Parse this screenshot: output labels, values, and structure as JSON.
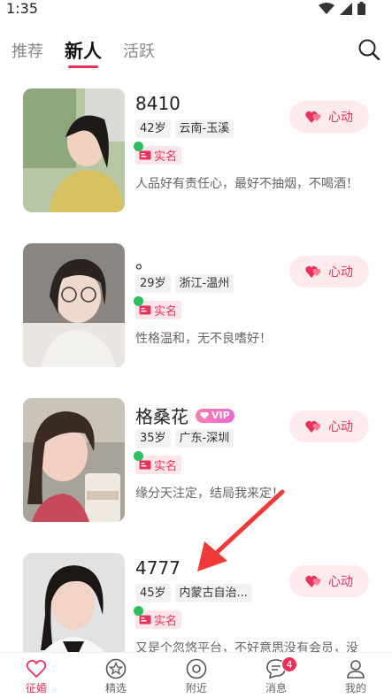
{
  "status_bar": {
    "time": "1:35"
  },
  "tabs": [
    {
      "label": "推荐",
      "active": false
    },
    {
      "label": "新人",
      "active": true
    },
    {
      "label": "活跃",
      "active": false
    }
  ],
  "profiles": [
    {
      "name": "8410",
      "vip": "",
      "age": "42岁",
      "location": "云南-玉溪",
      "verified": "实名",
      "bio": "人品好有责任心，最好不抽烟，不喝酒！",
      "like_label": "心动"
    },
    {
      "name": "。",
      "vip": "",
      "age": "29岁",
      "location": "浙江-温州",
      "verified": "实名",
      "bio": "性格温和，无不良嗜好！",
      "like_label": "心动"
    },
    {
      "name": "格桑花",
      "vip": "VIP",
      "age": "35岁",
      "location": "广东-深圳",
      "verified": "实名",
      "bio": "缘分天注定，结局我来定！",
      "like_label": "心动"
    },
    {
      "name": "4777",
      "vip": "",
      "age": "45岁",
      "location": "内蒙古自治...",
      "verified": "实名",
      "bio": "又是个忽悠平台，不好意思没有会员，没",
      "like_label": "心动"
    }
  ],
  "bottom_nav": [
    {
      "label": "征婚",
      "icon": "heart-icon",
      "active": true
    },
    {
      "label": "精选",
      "icon": "star-icon",
      "active": false
    },
    {
      "label": "附近",
      "icon": "location-icon",
      "active": false
    },
    {
      "label": "消息",
      "icon": "message-icon",
      "active": false,
      "badge": "4"
    },
    {
      "label": "我的",
      "icon": "user-icon",
      "active": false
    }
  ],
  "colors": {
    "accent": "#e8325a",
    "like_bg": "#fdeaec",
    "verified_green": "#2bbf5d"
  }
}
